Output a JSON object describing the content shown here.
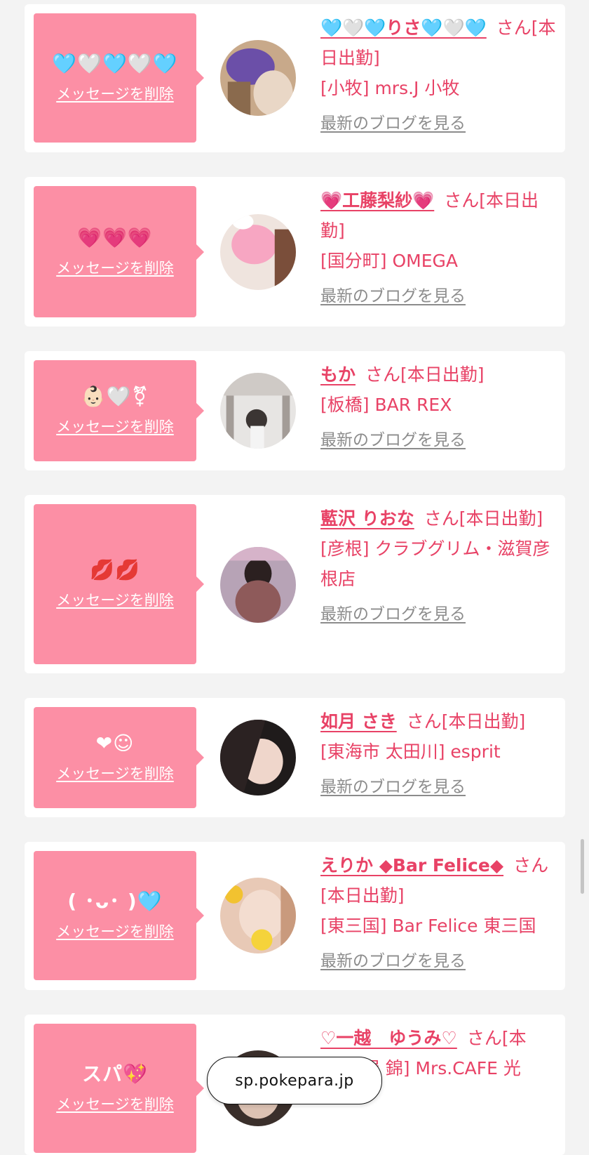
{
  "cards": [
    {
      "message": "🩵🤍🩵🤍🩵",
      "delete_label": "メッセージを削除",
      "name": "🩵🤍🩵りさ🩵🤍🩵",
      "suffix": "さん[本日出勤]",
      "shop": "[小牧] mrs.J 小牧",
      "blog_label": "最新のブログを見る"
    },
    {
      "message": "💗💗💗",
      "delete_label": "メッセージを削除",
      "name": "💗工藤梨紗💗",
      "suffix": "さん[本日出勤]",
      "shop": "[国分町] OMEGA",
      "blog_label": "最新のブログを見る"
    },
    {
      "message": "👶🏻🤍⚧",
      "delete_label": "メッセージを削除",
      "name": "もか",
      "suffix": "さん[本日出勤]",
      "shop": "[板橋] BAR REX",
      "blog_label": "最新のブログを見る"
    },
    {
      "message": "💋💋",
      "delete_label": "メッセージを削除",
      "name": "藍沢 りおな",
      "suffix": "さん[本日出勤]",
      "shop": "[彦根] クラブグリム・滋賀彦根店",
      "blog_label": "最新のブログを見る"
    },
    {
      "message": "❤☺",
      "delete_label": "メッセージを削除",
      "name": "如月 さき",
      "suffix": "さん[本日出勤]",
      "shop": "[東海市 太田川] esprit",
      "blog_label": "最新のブログを見る"
    },
    {
      "message": "( ･ᴗ･ )🩵",
      "delete_label": "メッセージを削除",
      "name": "えりか ◆Bar Felice◆",
      "suffix": "さん[本日出勤]",
      "shop": "[東三国] Bar Felice 東三国",
      "blog_label": "最新のブログを見る"
    },
    {
      "message": "スパ💖",
      "delete_label": "メッセージを削除",
      "name": "♡一越　ゆうみ♡",
      "suffix": "さん[本",
      "shop": "[名古屋 錦] Mrs.CAFE 光",
      "blog_label": ""
    }
  ],
  "browser": {
    "url": "sp.pokepara.jp"
  },
  "colors": {
    "accent": "#fc8fa5",
    "name_text": "#e84266",
    "blog_link": "#8c8c8c",
    "background": "#f3f3f3"
  }
}
